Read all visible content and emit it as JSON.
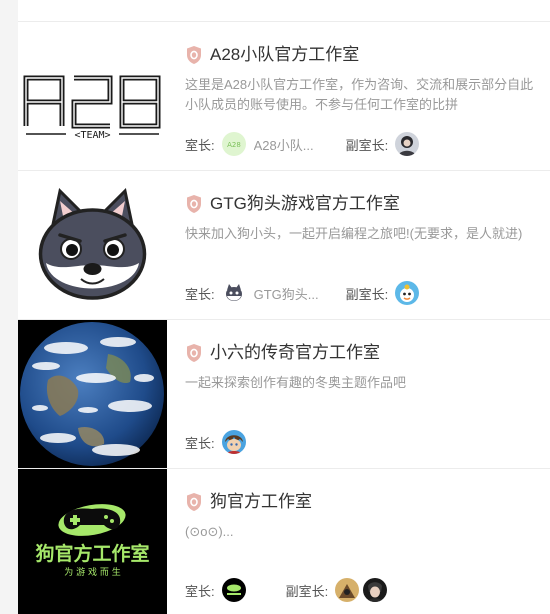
{
  "studios": [
    {
      "title": "A28小队官方工作室",
      "description": "这里是A28小队官方工作室，作为咨询、交流和展示部分自此小队成员的账号使用。不参与任何工作室的比拼",
      "description_line1": "这里是A28小队官方工作室，作为咨询、交流和展示部分自此",
      "description_line2": "小队成员的账号使用。不参与任何工作室的比拼",
      "logo_text": "A28",
      "logo_subtext": "<TEAM>",
      "owner_label": "室长:",
      "owner_name": "A28小队...",
      "deputy_label": "副室长:"
    },
    {
      "title": "GTG狗头游戏官方工作室",
      "description": "快来加入狗小头，一起开启编程之旅吧!(无要求，是人就进)",
      "owner_label": "室长:",
      "owner_name": "GTG狗头...",
      "deputy_label": "副室长:"
    },
    {
      "title": "小六的传奇官方工作室",
      "description": "一起来探索创作有趣的冬奥主题作品吧",
      "owner_label": "室长:"
    },
    {
      "title": "狗官方工作室",
      "description": "(⊙o⊙)...",
      "logo_text": "狗官方工作室",
      "logo_subtext": "为 游 戏 而 生",
      "owner_label": "室长:",
      "deputy_label": "副室长:"
    }
  ],
  "icons": {
    "badge": "shield-badge-icon",
    "a28_logo": "a28-team-logo",
    "doge": "doge-face-logo",
    "earth": "earth-image",
    "gamepad": "gamepad-logo"
  },
  "colors": {
    "badge_fill": "#e8b3ab",
    "title": "#333333",
    "description": "#999999",
    "divider": "#ececec",
    "brand_green": "#a6e86a"
  }
}
